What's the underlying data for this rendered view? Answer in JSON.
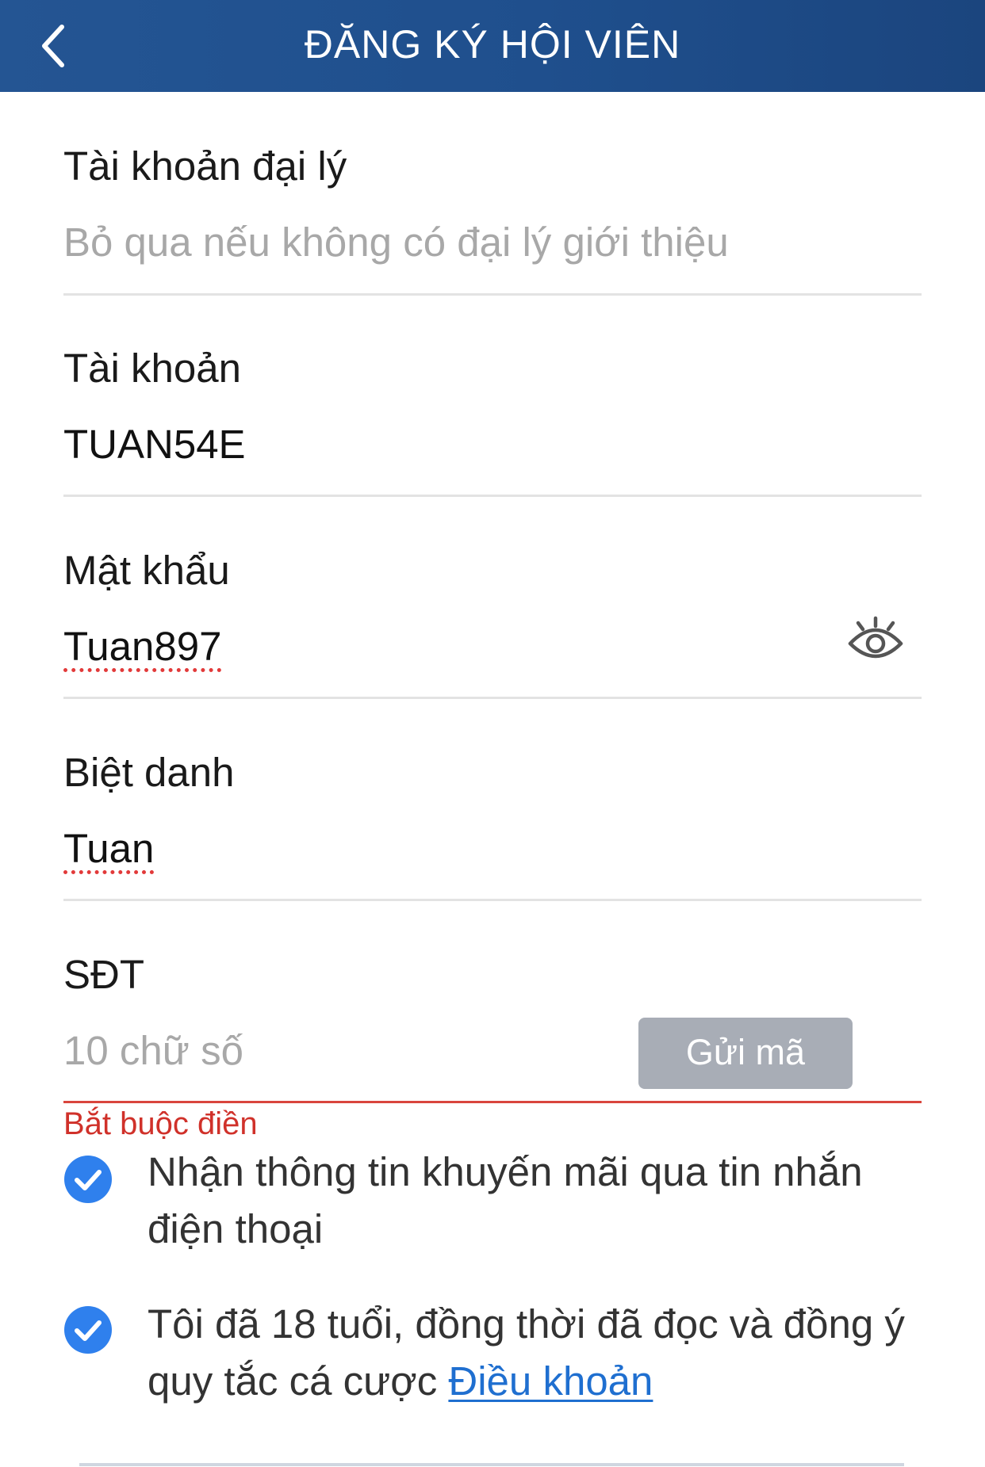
{
  "header": {
    "title": "ĐĂNG KÝ HỘI VIÊN"
  },
  "form": {
    "agent_account": {
      "label": "Tài khoản đại lý",
      "placeholder": "Bỏ qua nếu không có đại lý giới thiệu",
      "value": ""
    },
    "account": {
      "label": "Tài khoản",
      "value": "TUAN54E"
    },
    "password": {
      "label": "Mật khẩu",
      "value": "Tuan897"
    },
    "nickname": {
      "label": "Biệt danh",
      "value": "Tuan"
    },
    "phone": {
      "label": "SĐT",
      "placeholder": "10 chữ số",
      "value": "",
      "send_code_label": "Gửi mã",
      "error": "Bắt buộc điền"
    }
  },
  "checkboxes": {
    "promo": {
      "checked": true,
      "text": "Nhận thông tin khuyến mãi qua tin nhắn điện thoại"
    },
    "age_terms": {
      "checked": true,
      "text_before": "Tôi đã 18 tuổi, đồng thời đã đọc và đồng ý quy tắc cá cược ",
      "link_text": "Điều khoản"
    }
  },
  "colors": {
    "header_bg": "#1f4f8d",
    "checkbox_blue": "#2f80ed",
    "error_red": "#d0312a",
    "link_blue": "#1f6fd0",
    "send_button_disabled": "#a8adb6"
  },
  "icons": {
    "back": "chevron-left-icon",
    "password_toggle": "eye-icon",
    "checkbox": "checkmark-circle-icon"
  }
}
